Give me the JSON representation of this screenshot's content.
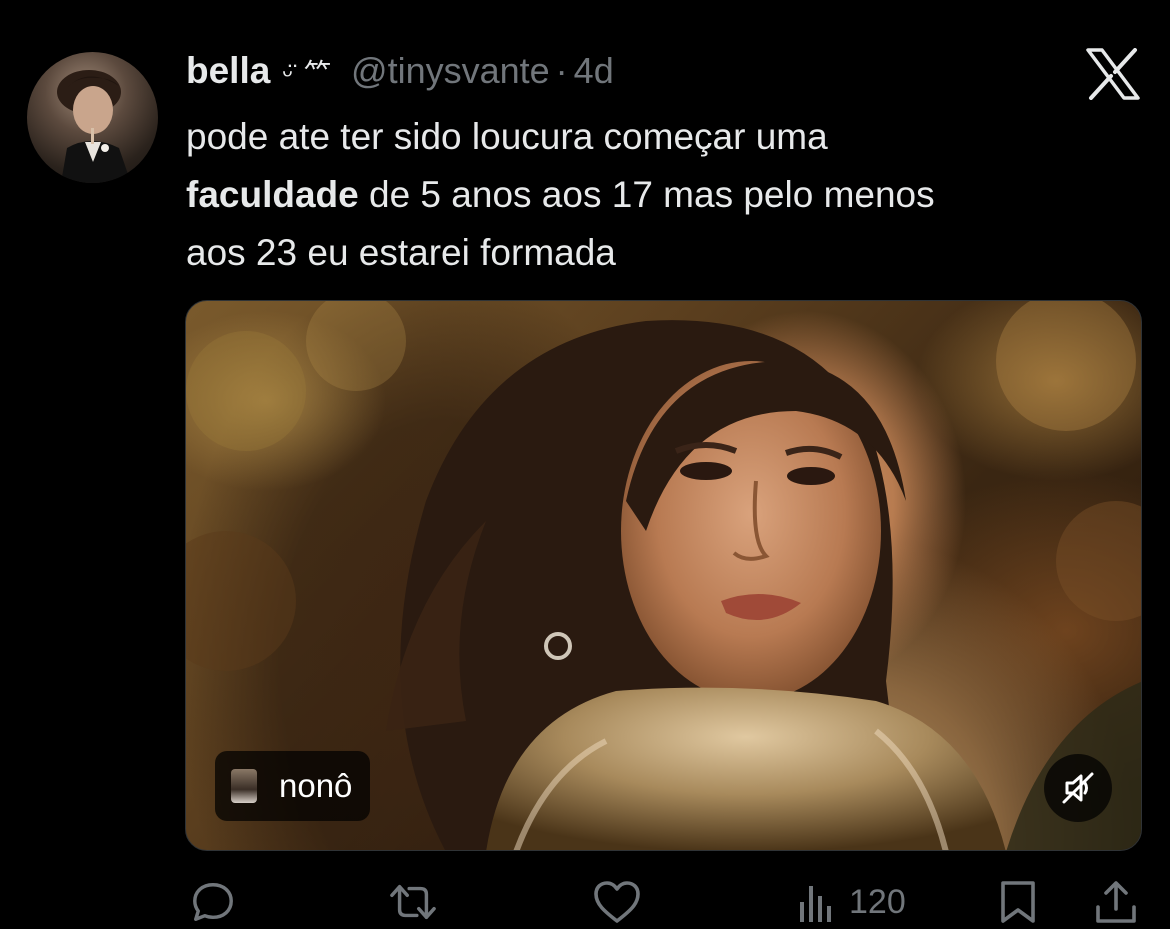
{
  "tweet": {
    "author": {
      "display_name": "bella",
      "name_decoration": "ᵕ̈ ⺮",
      "handle": "@tinysvante",
      "separator": "·",
      "time": "4d"
    },
    "text": {
      "line1": "pode ate ter sido loucura começar uma",
      "bold_word": "faculdade",
      "line2_rest": " de 5 anos aos 17 mas pelo menos",
      "line3": "aos 23 eu estarei formada"
    },
    "media": {
      "caption_label": "nonô",
      "mute_icon": "speaker-muted-icon"
    },
    "actions": {
      "reply_icon": "reply-bubble-icon",
      "retweet_icon": "retweet-icon",
      "like_icon": "heart-icon",
      "views_icon": "bar-chart-icon",
      "views_count": "120",
      "bookmark_icon": "bookmark-icon",
      "share_icon": "share-icon"
    },
    "brand": {
      "logo": "x-logo-icon"
    }
  },
  "colors": {
    "background": "#000000",
    "primary_text": "#e7e9ea",
    "secondary_text": "#71767b"
  }
}
